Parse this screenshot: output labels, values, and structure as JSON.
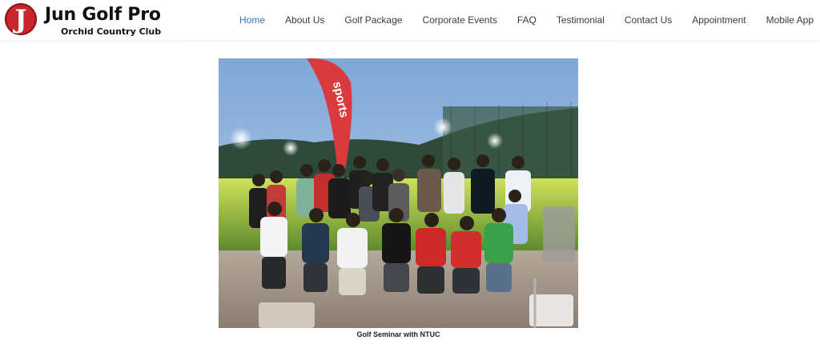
{
  "header": {
    "logo_letter": "J",
    "site_title": "Jun Golf Pro",
    "site_subtitle": "Orchid Country Club"
  },
  "nav": {
    "items": [
      {
        "label": "Home",
        "active": true
      },
      {
        "label": "About Us"
      },
      {
        "label": "Golf Package"
      },
      {
        "label": "Corporate Events"
      },
      {
        "label": "FAQ"
      },
      {
        "label": "Testimonial"
      },
      {
        "label": "Contact Us"
      },
      {
        "label": "Appointment"
      },
      {
        "label": "Mobile App"
      }
    ]
  },
  "main": {
    "photo": {
      "banner_text": "sports",
      "caption": "Golf Seminar with NTUC"
    }
  },
  "colors": {
    "brand_red": "#c8262c",
    "nav_active": "#3a72b8",
    "nav_text": "#3b3b3b"
  }
}
